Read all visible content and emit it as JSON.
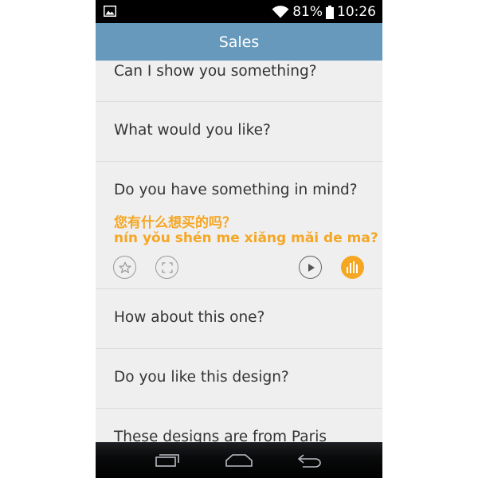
{
  "status_bar": {
    "battery": "81%",
    "time": "10:26",
    "icons": [
      "gallery-notification-icon",
      "wifi-icon",
      "battery-icon"
    ]
  },
  "app_bar": {
    "title": "Sales"
  },
  "phrases": [
    {
      "english": "Can I show you something?"
    },
    {
      "english": "What would you like?"
    },
    {
      "english": "Do you have something in mind?",
      "chinese": "您有什么想买的吗？",
      "pinyin": "nín yǒu shén me xiǎng mǎi de ma?",
      "actions": [
        "star-icon",
        "fullscreen-icon",
        "play-icon",
        "audio-waveform-icon"
      ]
    },
    {
      "english": "How about this one?"
    },
    {
      "english": "Do you like this design?"
    },
    {
      "english": "These designs are from Paris"
    }
  ],
  "nav_bar": {
    "buttons": [
      "recent-apps-icon",
      "home-icon",
      "back-icon"
    ]
  },
  "colors": {
    "app_bar": "#6699bb",
    "accent": "#f5a623",
    "list_bg": "#efefef",
    "text": "#333333"
  }
}
